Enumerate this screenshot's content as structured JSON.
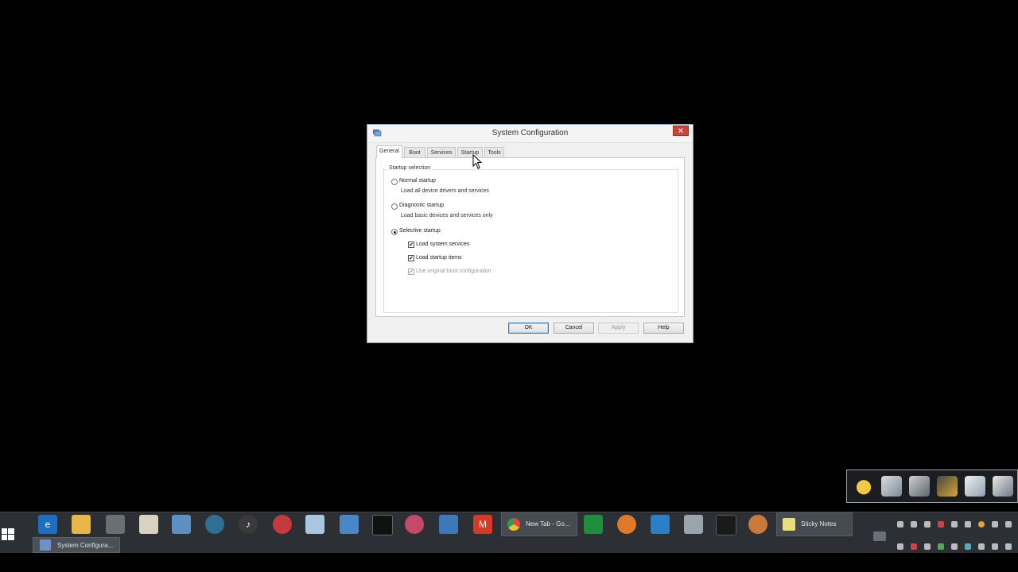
{
  "dialog": {
    "title": "System Configuration",
    "close_glyph": "✕",
    "tabs": [
      "General",
      "Boot",
      "Services",
      "Startup",
      "Tools"
    ],
    "active_tab": "General",
    "group_label": "Startup selection",
    "options": {
      "normal": {
        "label": "Normal startup",
        "description": "Load all device drivers and services",
        "checked": false
      },
      "diagnostic": {
        "label": "Diagnostic startup",
        "description": "Load basic devices and services only",
        "checked": false
      },
      "selective": {
        "label": "Selective startup",
        "checked": true
      }
    },
    "checkboxes": {
      "system_services": {
        "label": "Load system services",
        "checked": true
      },
      "startup_items": {
        "label": "Load startup items",
        "checked": true
      },
      "original_boot": {
        "label": "Use original boot configuration",
        "checked": true,
        "disabled": true
      }
    },
    "check_glyph": "✔",
    "buttons": {
      "ok": "OK",
      "cancel": "Cancel",
      "apply": "Apply",
      "help": "Help"
    }
  },
  "taskbar": {
    "pinned_icons": [
      "internet-explorer-icon",
      "file-explorer-icon",
      "media-icon",
      "document-icon",
      "app-icon",
      "globe-icon",
      "music-icon",
      "game-icon",
      "notepad-icon",
      "mail-icon",
      "terminal-icon",
      "paint-icon",
      "remote-icon",
      "mcafee-icon",
      "chrome-icon",
      "spreadsheet-icon",
      "firefox-icon",
      "text-editor-icon",
      "printer-icon",
      "monitor-icon",
      "user-icon"
    ],
    "chrome_window": "New Tab - Go...",
    "sticky_notes": "Sticky Notes",
    "active_window": "System Configura...",
    "accent": "#2c2f33"
  },
  "tray_overflow": {
    "icons": [
      "smiley-icon",
      "network-user-icon",
      "network-drive-icon",
      "pen-icon",
      "devices-icon",
      "computer-icon"
    ]
  }
}
